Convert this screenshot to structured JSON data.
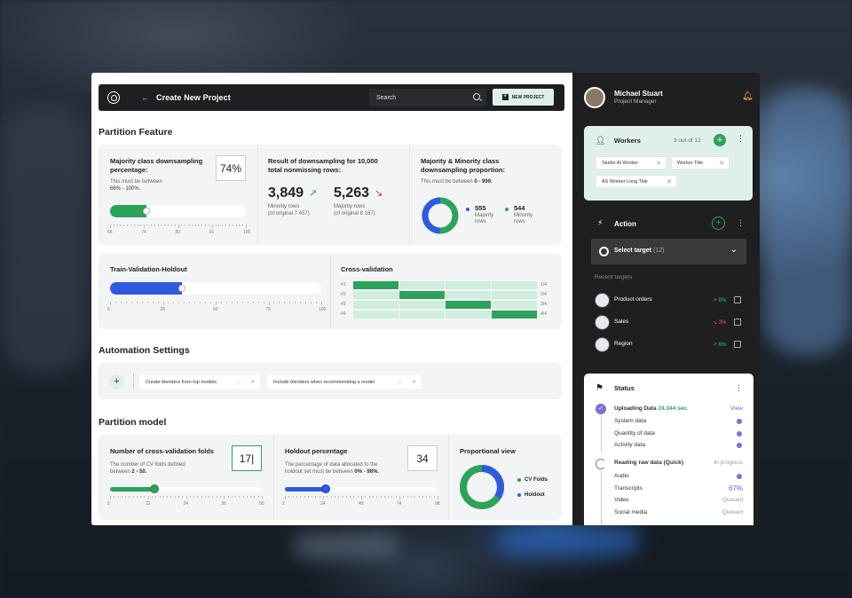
{
  "topbar": {
    "title": "Create New Project",
    "back": "←",
    "search_placeholder": "Search",
    "new_project": "NEW PROJECT"
  },
  "partition_feature": {
    "heading": "Partition Feature",
    "majority": {
      "title": "Majority class downsampling percentage:",
      "value": "74%",
      "hint": "This must be between",
      "range": "66% - 100%.",
      "ticks": [
        "66",
        "74",
        "83",
        "91",
        "100"
      ],
      "fill": 0.27
    },
    "result": {
      "title": "Result of downsampling for 10,000 total nonmissing rows:",
      "a_value": "3,849",
      "a_l1": "Minority rows",
      "a_l2": "(of original 7 457)",
      "b_value": "5,263",
      "b_l1": "Majority rows",
      "b_l2": "(of original 8 167)"
    },
    "proportion": {
      "title": "Majority & Minority class downsampling proportion:",
      "hint": "This must be between",
      "range": "0 - 999.",
      "a_value": "555",
      "a_label": "Majority rows",
      "b_value": "544",
      "b_label": "Minority rows",
      "share_a": 0.5
    }
  },
  "tvh": {
    "title": "Train-Validation-Holdout",
    "ticks": [
      "0",
      "25",
      "50",
      "75",
      "100"
    ],
    "fill": 0.34
  },
  "cv": {
    "title": "Cross-validation",
    "rows": [
      "#1",
      "#2",
      "#3",
      "#4"
    ],
    "right": [
      "1/4",
      "2/4",
      "3/4",
      "4/4"
    ]
  },
  "automation": {
    "heading": "Automation Settings",
    "chip1": "Create blenders from top models",
    "chip2": "Include blenders when recommending a model",
    "add": "+"
  },
  "partition_model": {
    "heading": "Partition model",
    "folds": {
      "title": "Number of cross-validation folds",
      "value": "17|",
      "desc1": "The number of CV folds defined",
      "desc2": "between",
      "range": "2 - 50.",
      "ticks": [
        "2",
        "12",
        "24",
        "36",
        "50"
      ],
      "fill": 0.29
    },
    "holdout": {
      "title": "Holdout percentage",
      "value": "34",
      "desc1": "The percentage of data allocated to the",
      "desc2": "holdout set must be between",
      "range": "0% - 98%.",
      "ticks": [
        "2",
        "24",
        "49",
        "74",
        "98"
      ],
      "fill": 0.27
    },
    "prop": {
      "title": "Proportional view",
      "leg1": "CV Folds",
      "leg2": "Holdout"
    }
  },
  "user": {
    "name": "Michael Stuart",
    "role": "Project Manager"
  },
  "workers": {
    "title": "Workers",
    "count": "3 out of 12",
    "chips": [
      "Studio AI Worker",
      "Worker Title",
      "AS Worker Long Title"
    ]
  },
  "action": {
    "title": "Action",
    "select": "Select target",
    "select_count": "(12)",
    "recent": "Recent targets",
    "targets": [
      {
        "name": "Product orders",
        "pct": "8%",
        "dir": "↗",
        "color": "#2bc46a"
      },
      {
        "name": "Sales",
        "pct": "3%",
        "dir": "↘",
        "color": "#e85c5c"
      },
      {
        "name": "Region",
        "pct": "6%",
        "dir": "↗",
        "color": "#2bc46a"
      }
    ]
  },
  "status": {
    "title": "Status",
    "uploading": "Uploading Data",
    "uploading_speed": "24.344 sec.",
    "view": "View",
    "up_items": [
      "System data",
      "Quantity of data",
      "Activity data"
    ],
    "reading": "Reading raw data (Quick)",
    "reading_state": "In progress",
    "read_items": [
      {
        "name": "Audio",
        "state": ""
      },
      {
        "name": "Transcripts",
        "state": "67%"
      },
      {
        "name": "Video",
        "state": "Queued"
      },
      {
        "name": "Social media",
        "state": "Queued"
      }
    ]
  },
  "colors": {
    "green": "#2da35a",
    "blue": "#2f5ae0",
    "dark": "#1f1f21",
    "mint": "#dff0ec"
  }
}
